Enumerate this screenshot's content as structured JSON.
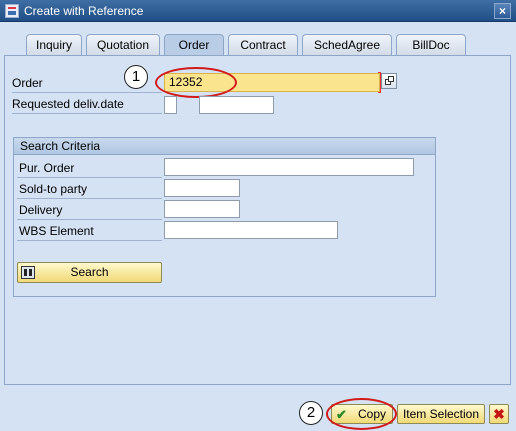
{
  "window": {
    "title": "Create with Reference",
    "close_label": "×"
  },
  "tabs": [
    "Inquiry",
    "Quotation",
    "Order",
    "Contract",
    "SchedAgree",
    "BillDoc"
  ],
  "active_tab": "Order",
  "order": {
    "label": "Order",
    "value": "12352"
  },
  "requested_deliv_date": {
    "label": "Requested deliv.date",
    "value_a": "",
    "value_b": ""
  },
  "search_criteria": {
    "title": "Search Criteria",
    "fields": [
      {
        "label": "Pur. Order",
        "value": ""
      },
      {
        "label": "Sold-to party",
        "value": ""
      },
      {
        "label": "Delivery",
        "value": ""
      },
      {
        "label": "WBS Element",
        "value": ""
      }
    ],
    "search_button": "Search"
  },
  "footer": {
    "copy_button": "Copy",
    "item_selection_button": "Item Selection",
    "cancel_icon": "close-icon"
  },
  "callouts": [
    "1",
    "2"
  ],
  "colors": {
    "title_bar": "#2a5b95",
    "input_highlight": "#fbe48e",
    "callout": "#d11a1a",
    "button": "#f5e295"
  }
}
